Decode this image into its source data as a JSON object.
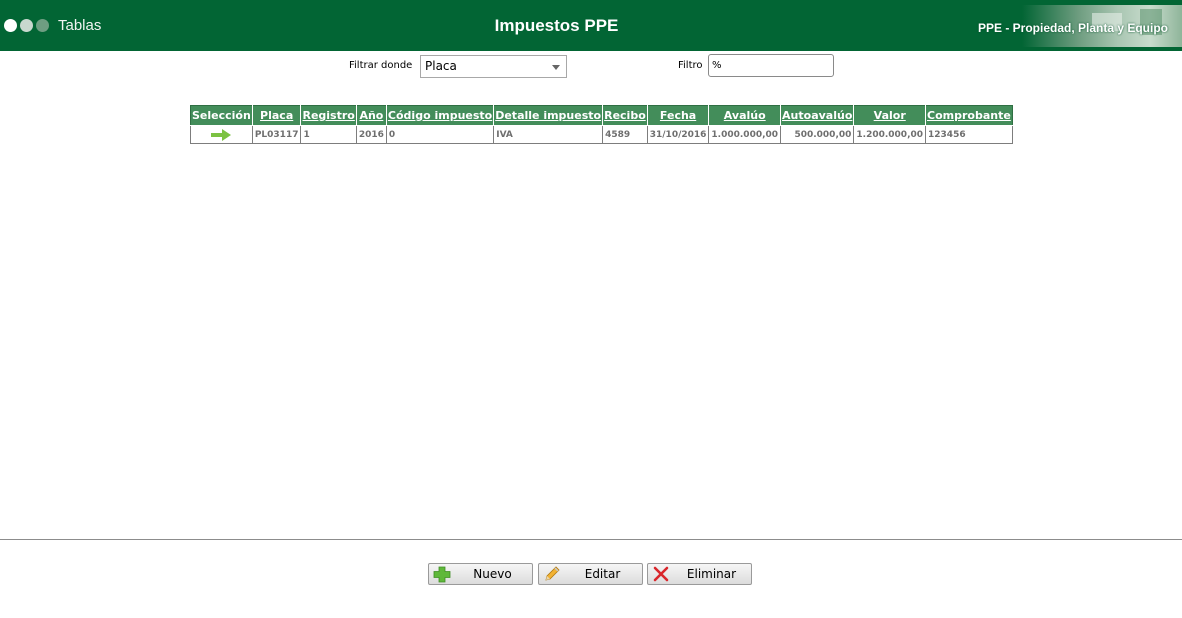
{
  "header": {
    "brand": "Tablas",
    "title": "Impuestos PPE",
    "module": "PPE - Propiedad, Planta y Equipo"
  },
  "filters": {
    "filter_where_label": "Filtrar donde",
    "filter_where_value": "Placa",
    "filter_label": "Filtro",
    "filter_value": "%"
  },
  "table": {
    "columns": [
      "Selección",
      "Placa",
      "Registro",
      "Año",
      "Código impuesto",
      "Detalle impuesto",
      "Recibo",
      "Fecha",
      "Avalúo",
      "Autoavalúo",
      "Valor",
      "Comprobante"
    ],
    "rows": [
      {
        "placa": "PL03117",
        "registro": "1",
        "anio": "2016",
        "codigo_impuesto": "0",
        "detalle_impuesto": "IVA",
        "recibo": "4589",
        "fecha": "31/10/2016",
        "avaluo": "1.000.000,00",
        "autoavaluo": "500.000,00",
        "valor": "1.200.000,00",
        "comprobante": "123456"
      }
    ]
  },
  "buttons": {
    "new_label": "Nuevo",
    "edit_label": "Editar",
    "delete_label": "Eliminar"
  },
  "icons": {
    "select_row": "arrow-right-icon",
    "new": "plus-icon",
    "edit": "pencil-icon",
    "delete": "x-icon"
  },
  "colors": {
    "header_bg": "#026534",
    "grid_header_bg": "#438d5a",
    "select_arrow": "#7cc242"
  }
}
